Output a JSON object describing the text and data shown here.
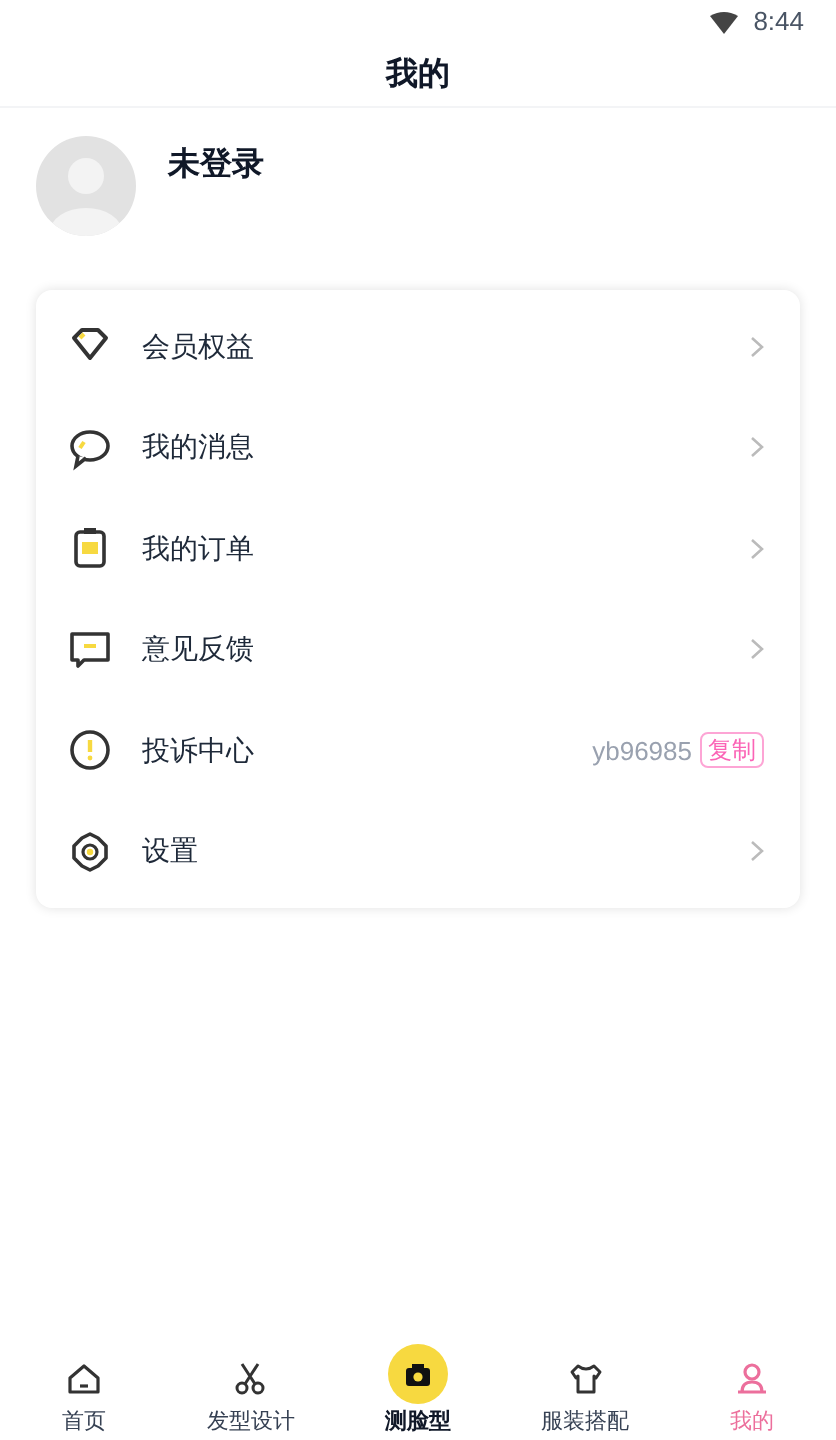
{
  "status_bar": {
    "time": "8:44"
  },
  "header": {
    "title": "我的"
  },
  "profile": {
    "name": "未登录"
  },
  "menu": [
    {
      "kind": "link",
      "label": "会员权益"
    },
    {
      "kind": "link",
      "label": "我的消息"
    },
    {
      "kind": "link",
      "label": "我的订单"
    },
    {
      "kind": "link",
      "label": "意见反馈"
    },
    {
      "kind": "copy",
      "label": "投诉中心",
      "value": "yb96985",
      "action": "复制"
    },
    {
      "kind": "link",
      "label": "设置"
    }
  ],
  "tab_bar": [
    {
      "label": "首页",
      "selected": false,
      "kind": "normal"
    },
    {
      "label": "发型设计",
      "selected": false,
      "kind": "normal"
    },
    {
      "label": "测脸型",
      "selected": false,
      "kind": "featured"
    },
    {
      "label": "服装搭配",
      "selected": false,
      "kind": "normal"
    },
    {
      "label": "我的",
      "selected": true,
      "kind": "normal"
    }
  ]
}
